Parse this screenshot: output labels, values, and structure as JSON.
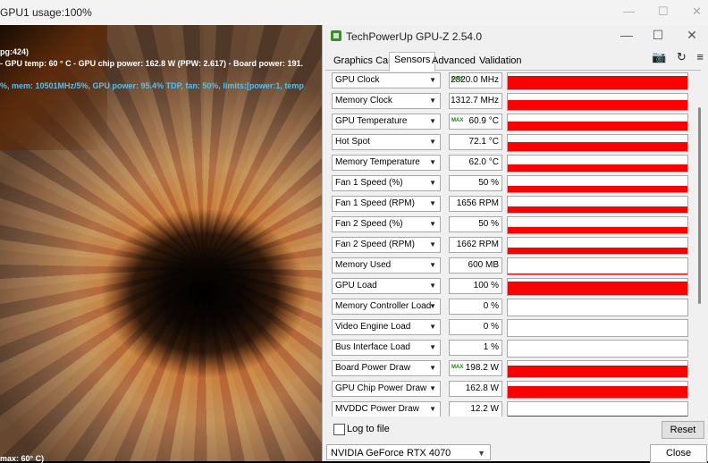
{
  "background_window": {
    "title": "GPU1 usage:100%",
    "controls": {
      "minimize": "—",
      "maximize": "☐",
      "close": "✕"
    },
    "osd": {
      "line1": "pg:424)",
      "line2": "- GPU temp: 60 ° C - GPU chip power: 162.8 W (PPW: 2.617) - Board power: 191.",
      "line3": "%, mem: 10501MHz/5%, GPU power: 95.4% TDP, fan: 50%, limits:[power:1, temp",
      "bottom": "max: 60° C)"
    }
  },
  "gpuz": {
    "title": "TechPowerUp GPU-Z 2.54.0",
    "window_controls": {
      "minimize": "—",
      "maximize": "☐",
      "close": "✕"
    },
    "tabs": [
      {
        "label": "Graphics Card",
        "active": false
      },
      {
        "label": "Sensors",
        "active": true
      },
      {
        "label": "Advanced",
        "active": false
      },
      {
        "label": "Validation",
        "active": false
      }
    ],
    "toolbar": {
      "camera_icon": "📷",
      "refresh_icon": "↻",
      "menu_icon": "≡"
    },
    "max_label": "MAX",
    "sensors": [
      {
        "name": "GPU Clock",
        "value": "2820.0 MHz",
        "max": true,
        "level": 0.85
      },
      {
        "name": "Memory Clock",
        "value": "1312.7 MHz",
        "max": false,
        "level": 0.6
      },
      {
        "name": "GPU Temperature",
        "value": "60.9 °C",
        "max": true,
        "level": 0.55
      },
      {
        "name": "Hot Spot",
        "value": "72.1 °C",
        "max": false,
        "level": 0.55
      },
      {
        "name": "Memory Temperature",
        "value": "62.0 °C",
        "max": false,
        "level": 0.45
      },
      {
        "name": "Fan 1 Speed (%)",
        "value": "50 %",
        "max": false,
        "level": 0.4
      },
      {
        "name": "Fan 1 Speed (RPM)",
        "value": "1656 RPM",
        "max": false,
        "level": 0.4
      },
      {
        "name": "Fan 2 Speed (%)",
        "value": "50 %",
        "max": false,
        "level": 0.4
      },
      {
        "name": "Fan 2 Speed (RPM)",
        "value": "1662 RPM",
        "max": false,
        "level": 0.4
      },
      {
        "name": "Memory Used",
        "value": "600 MB",
        "max": false,
        "level": 0.05
      },
      {
        "name": "GPU Load",
        "value": "100 %",
        "max": false,
        "level": 0.85
      },
      {
        "name": "Memory Controller Load",
        "value": "0 %",
        "max": false,
        "level": 0
      },
      {
        "name": "Video Engine Load",
        "value": "0 %",
        "max": false,
        "level": 0
      },
      {
        "name": "Bus Interface Load",
        "value": "1 %",
        "max": false,
        "level": 0.02
      },
      {
        "name": "Board Power Draw",
        "value": "198.2 W",
        "max": true,
        "level": 0.75
      },
      {
        "name": "GPU Chip Power Draw",
        "value": "162.8 W",
        "max": false,
        "level": 0.75
      },
      {
        "name": "MVDDC Power Draw",
        "value": "12.2 W",
        "max": false,
        "level": 0.15
      }
    ],
    "log_to_file_label": "Log to file",
    "reset_label": "Reset",
    "gpu_select_value": "NVIDIA GeForce RTX 4070",
    "close_label": "Close",
    "colors": {
      "graph": "#ff0000",
      "max_tag": "#0a8a0a"
    }
  }
}
